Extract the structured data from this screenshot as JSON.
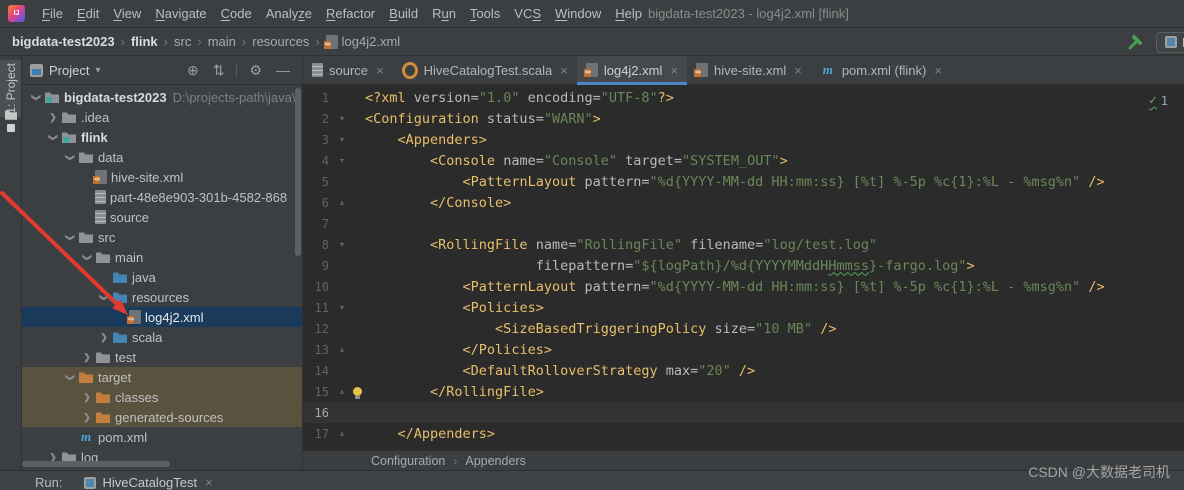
{
  "window": {
    "title": "bigdata-test2023 - log4j2.xml [flink]"
  },
  "menu": {
    "items": [
      {
        "label": "File",
        "u": 0
      },
      {
        "label": "Edit",
        "u": 0
      },
      {
        "label": "View",
        "u": 0
      },
      {
        "label": "Navigate",
        "u": 0
      },
      {
        "label": "Code",
        "u": 0
      },
      {
        "label": "Analyze",
        "u": 5
      },
      {
        "label": "Refactor",
        "u": 0
      },
      {
        "label": "Build",
        "u": 0
      },
      {
        "label": "Run",
        "u": 1
      },
      {
        "label": "Tools",
        "u": 0
      },
      {
        "label": "VCS",
        "u": 2
      },
      {
        "label": "Window",
        "u": 0
      },
      {
        "label": "Help",
        "u": 0
      }
    ]
  },
  "navbar": {
    "crumbs": [
      {
        "label": "bigdata-test2023",
        "bold": true
      },
      {
        "label": "flink",
        "bold": true
      },
      {
        "label": "src"
      },
      {
        "label": "main"
      },
      {
        "label": "resources"
      },
      {
        "label": "log4j2.xml",
        "icon": "file-xml"
      }
    ],
    "run_chip_label": "H"
  },
  "tool_stripe": {
    "label": "1: Project"
  },
  "project_panel": {
    "title": "Project",
    "tree": [
      {
        "label": "bigdata-test2023",
        "depth": 0,
        "icon": "folder-module",
        "arrow": "open",
        "bold": true,
        "extra": "D:\\projects-path\\java\\"
      },
      {
        "label": ".idea",
        "depth": 1,
        "icon": "folder-gray",
        "arrow": "closed"
      },
      {
        "label": "flink",
        "depth": 1,
        "icon": "folder-module",
        "arrow": "open",
        "bold": true
      },
      {
        "label": "data",
        "depth": 2,
        "icon": "folder-gray",
        "arrow": "open"
      },
      {
        "label": "hive-site.xml",
        "depth": 3,
        "icon": "file-xml"
      },
      {
        "label": "part-48e8e903-301b-4582-868",
        "depth": 3,
        "icon": "file-text"
      },
      {
        "label": "source",
        "depth": 3,
        "icon": "file-text"
      },
      {
        "label": "src",
        "depth": 2,
        "icon": "folder-gray",
        "arrow": "open"
      },
      {
        "label": "main",
        "depth": 3,
        "icon": "folder-gray",
        "arrow": "open"
      },
      {
        "label": "java",
        "depth": 4,
        "icon": "folder-src"
      },
      {
        "label": "resources",
        "depth": 4,
        "icon": "folder-src",
        "arrow": "open"
      },
      {
        "label": "log4j2.xml",
        "depth": 5,
        "icon": "file-xml",
        "selected": true
      },
      {
        "label": "scala",
        "depth": 4,
        "icon": "folder-src",
        "arrow": "closed"
      },
      {
        "label": "test",
        "depth": 3,
        "icon": "folder-gray",
        "arrow": "closed"
      },
      {
        "label": "target",
        "depth": 2,
        "icon": "folder-excl",
        "arrow": "open",
        "hl": true
      },
      {
        "label": "classes",
        "depth": 3,
        "icon": "folder-excl",
        "arrow": "closed",
        "hl": true
      },
      {
        "label": "generated-sources",
        "depth": 3,
        "icon": "folder-excl",
        "arrow": "closed",
        "hl": true
      },
      {
        "label": "pom.xml",
        "depth": 2,
        "icon": "file-maven"
      },
      {
        "label": "log",
        "depth": 1,
        "icon": "folder-gray",
        "arrow": "closed"
      }
    ]
  },
  "tabs": [
    {
      "label": "source",
      "icon": "file-text"
    },
    {
      "label": "HiveCatalogTest.scala",
      "icon": "file-scala"
    },
    {
      "label": "log4j2.xml",
      "icon": "file-xml",
      "active": true
    },
    {
      "label": "hive-site.xml",
      "icon": "file-xml"
    },
    {
      "label": "pom.xml (flink)",
      "icon": "file-maven"
    }
  ],
  "editor": {
    "inspection_count": "1",
    "breadcrumbs": [
      "Configuration",
      "Appenders"
    ],
    "lines": [
      {
        "n": 1,
        "fold": "",
        "segs": [
          [
            "<?xml",
            "t"
          ],
          [
            " version",
            "a"
          ],
          [
            "=",
            "a"
          ],
          [
            "\"1.0\"",
            "s"
          ],
          [
            " encoding",
            "a"
          ],
          [
            "=",
            "a"
          ],
          [
            "\"UTF-8\"",
            "s"
          ],
          [
            "?>",
            "t"
          ]
        ]
      },
      {
        "n": 2,
        "fold": "open",
        "segs": [
          [
            "<Configuration",
            "t"
          ],
          [
            " status",
            "a"
          ],
          [
            "=",
            "a"
          ],
          [
            "\"WARN\"",
            "s"
          ],
          [
            ">",
            "t"
          ]
        ]
      },
      {
        "n": 3,
        "fold": "open",
        "segs": [
          [
            "    ",
            "p"
          ],
          [
            "<Appenders>",
            "t"
          ]
        ]
      },
      {
        "n": 4,
        "fold": "open",
        "segs": [
          [
            "        ",
            "p"
          ],
          [
            "<Console",
            "t"
          ],
          [
            " name",
            "a"
          ],
          [
            "=",
            "a"
          ],
          [
            "\"Console\"",
            "s"
          ],
          [
            " target",
            "a"
          ],
          [
            "=",
            "a"
          ],
          [
            "\"SYSTEM_OUT\"",
            "s"
          ],
          [
            ">",
            "t"
          ]
        ]
      },
      {
        "n": 5,
        "fold": "",
        "segs": [
          [
            "            ",
            "p"
          ],
          [
            "<PatternLayout",
            "t"
          ],
          [
            " pattern",
            "a"
          ],
          [
            "=",
            "a"
          ],
          [
            "\"%d{YYYY-MM-dd HH:mm:ss} [%t] %-5p %c{1}:%L - %msg%n\"",
            "s"
          ],
          [
            " />",
            "t"
          ]
        ]
      },
      {
        "n": 6,
        "fold": "close",
        "segs": [
          [
            "        ",
            "p"
          ],
          [
            "</Console>",
            "t"
          ]
        ]
      },
      {
        "n": 7,
        "fold": "",
        "segs": []
      },
      {
        "n": 8,
        "fold": "open",
        "segs": [
          [
            "        ",
            "p"
          ],
          [
            "<RollingFile",
            "t"
          ],
          [
            " name",
            "a"
          ],
          [
            "=",
            "a"
          ],
          [
            "\"RollingFile\"",
            "s"
          ],
          [
            " filename",
            "a"
          ],
          [
            "=",
            "a"
          ],
          [
            "\"log/test.log\"",
            "s"
          ]
        ]
      },
      {
        "n": 9,
        "fold": "",
        "segs": [
          [
            "                     ",
            "p"
          ],
          [
            "filepattern",
            "a"
          ],
          [
            "=",
            "a"
          ],
          [
            "\"${logPath}/%d{YYYYMMddH",
            "s"
          ],
          [
            "Hmmss",
            "e"
          ],
          [
            "}-fargo.log\"",
            "s"
          ],
          [
            ">",
            "t"
          ]
        ]
      },
      {
        "n": 10,
        "fold": "",
        "segs": [
          [
            "            ",
            "p"
          ],
          [
            "<PatternLayout",
            "t"
          ],
          [
            " pattern",
            "a"
          ],
          [
            "=",
            "a"
          ],
          [
            "\"%d{YYYY-MM-dd HH:mm:ss} [%t] %-5p %c{1}:%L - %msg%n\"",
            "s"
          ],
          [
            " />",
            "t"
          ]
        ]
      },
      {
        "n": 11,
        "fold": "open",
        "segs": [
          [
            "            ",
            "p"
          ],
          [
            "<Policies>",
            "t"
          ]
        ]
      },
      {
        "n": 12,
        "fold": "",
        "segs": [
          [
            "                ",
            "p"
          ],
          [
            "<SizeBasedTriggeringPolicy",
            "t"
          ],
          [
            " size",
            "a"
          ],
          [
            "=",
            "a"
          ],
          [
            "\"10 MB\"",
            "s"
          ],
          [
            " />",
            "t"
          ]
        ]
      },
      {
        "n": 13,
        "fold": "close",
        "segs": [
          [
            "            ",
            "p"
          ],
          [
            "</Policies>",
            "t"
          ]
        ]
      },
      {
        "n": 14,
        "fold": "",
        "segs": [
          [
            "            ",
            "p"
          ],
          [
            "<DefaultRolloverStrategy",
            "t"
          ],
          [
            " max",
            "a"
          ],
          [
            "=",
            "a"
          ],
          [
            "\"20\"",
            "s"
          ],
          [
            " />",
            "t"
          ]
        ]
      },
      {
        "n": 15,
        "fold": "close",
        "bulb": true,
        "segs": [
          [
            "        ",
            "p"
          ],
          [
            "</RollingFile>",
            "t"
          ]
        ]
      },
      {
        "n": 16,
        "fold": "",
        "cur": true,
        "segs": []
      },
      {
        "n": 17,
        "fold": "close",
        "segs": [
          [
            "    ",
            "p"
          ],
          [
            "</Appenders>",
            "t"
          ]
        ]
      }
    ]
  },
  "run_bar": {
    "label": "Run:",
    "tab": "HiveCatalogTest"
  },
  "watermark": "CSDN @大数据老司机",
  "colors": {
    "accent_blue": "#4a88c7",
    "selection_blue": "#1a3a5c",
    "excluded_highlight": "#5a523f",
    "tag_yellow": "#e8bf6a",
    "string_green": "#6a8759",
    "arrow_red": "#e23a2e",
    "editor_bg": "#2b2b2b",
    "panel_bg": "#3c3f41"
  }
}
